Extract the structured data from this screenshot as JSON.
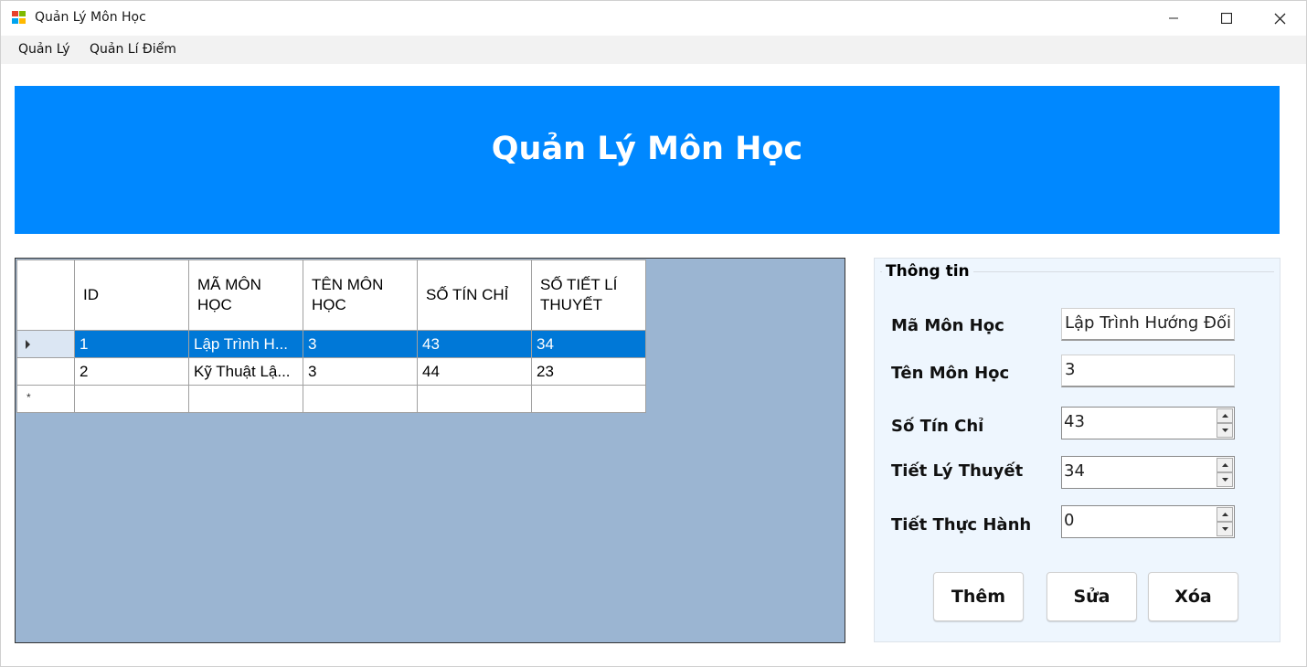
{
  "window": {
    "title": "Quản Lý Môn Học"
  },
  "menu": {
    "items": [
      "Quản Lý",
      "Quản Lí Điểm"
    ]
  },
  "banner": {
    "title": "Quản Lý Môn Học",
    "color": "#0088ff"
  },
  "grid": {
    "columns": [
      "ID",
      "MÃ MÔN HỌC",
      "TÊN MÔN HỌC",
      "SỐ TÍN CHỈ",
      "SỐ TIẾT LÍ THUYẾT"
    ],
    "rows": [
      [
        "1",
        "Lập Trình H...",
        "3",
        "43",
        "34"
      ],
      [
        "2",
        "Kỹ Thuật Lậ...",
        "3",
        "44",
        "23"
      ]
    ],
    "selected_row": 0,
    "new_row_marker": "*"
  },
  "info": {
    "title": "Thông tin",
    "ma_mon_hoc_label": "Mã Môn Học",
    "ma_mon_hoc_value": "Lập Trình Hướng Đối Tượng",
    "ten_mon_hoc_label": "Tên Môn Học",
    "ten_mon_hoc_value": "3",
    "so_tin_chi_label": "Số Tín Chỉ",
    "so_tin_chi_value": "43",
    "tiet_ly_thuyet_label": "Tiết Lý Thuyết",
    "tiet_ly_thuyet_value": "34",
    "tiet_thuc_hanh_label": "Tiết Thực Hành",
    "tiet_thuc_hanh_value": "0"
  },
  "buttons": {
    "them": "Thêm",
    "sua": "Sửa",
    "xoa": "Xóa"
  },
  "colors": {
    "selection": "#0078d7",
    "grid_background": "#9bb5d2",
    "groupbox_background": "#eef6fe"
  }
}
